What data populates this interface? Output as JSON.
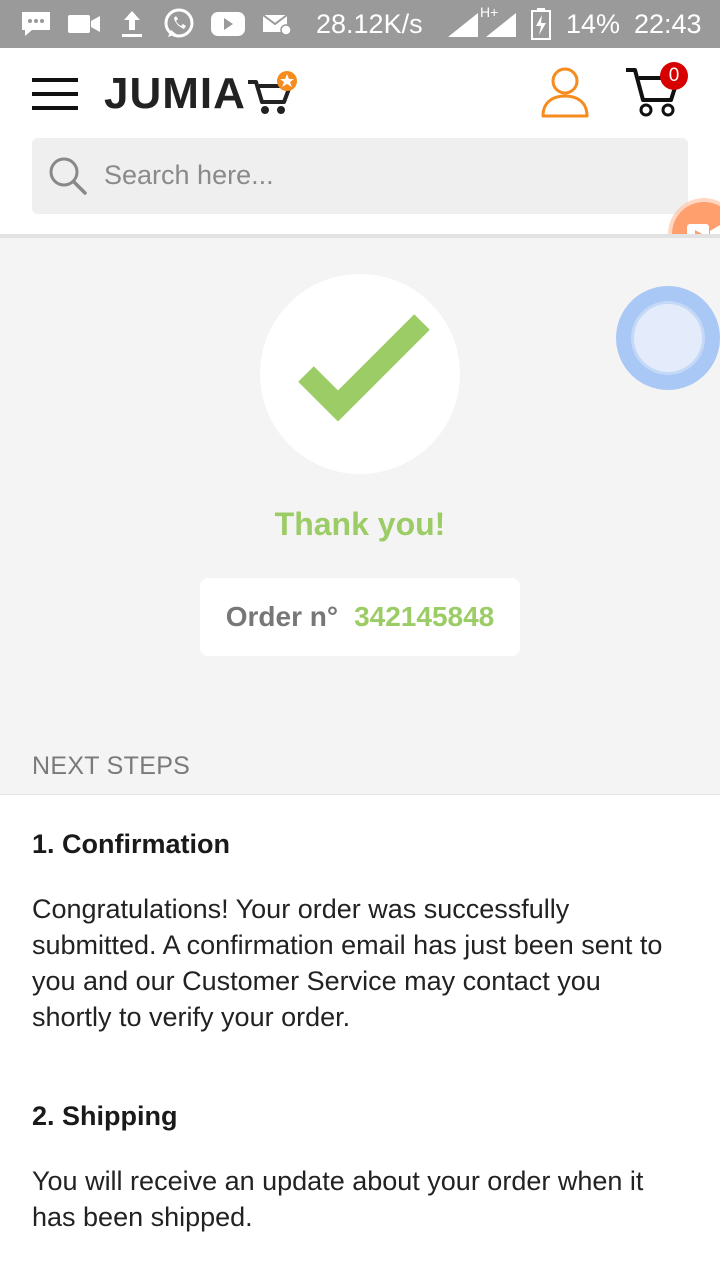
{
  "status_bar": {
    "net_speed": "28.12K/s",
    "battery": "14%",
    "time": "22:43",
    "network": "H+",
    "icons": [
      "message-icon",
      "video-icon",
      "upload-icon",
      "whatsapp-icon",
      "youtube-icon",
      "mail-icon",
      "signal-icon",
      "battery-charging-icon"
    ]
  },
  "header": {
    "logo": "JUMIA",
    "cart_count": "0",
    "search_placeholder": "Search here..."
  },
  "confirmation": {
    "thank_you": "Thank you!",
    "order_label": "Order n°",
    "order_number": "342145848"
  },
  "next_steps": {
    "heading": "NEXT STEPS",
    "steps": [
      {
        "title": "1. Confirmation",
        "body": "Congratulations! Your order was successfully submitted. A confirmation email has just been sent to you and our Customer Service may contact you shortly to verify your order."
      },
      {
        "title": "2. Shipping",
        "body": "You will receive an update about your order when it has been shipped."
      }
    ]
  },
  "colors": {
    "brand_orange": "#f68b1e",
    "success_green": "#9ccc65",
    "badge_red": "#d60000"
  }
}
